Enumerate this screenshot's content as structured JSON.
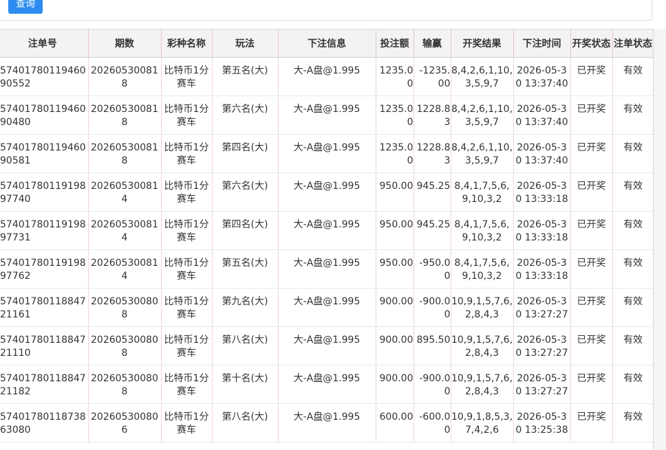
{
  "toolbar": {
    "query_label": "查询"
  },
  "table": {
    "headers": [
      "注单号",
      "期数",
      "彩种名称",
      "玩法",
      "下注信息",
      "投注额",
      "输赢",
      "开奖结果",
      "下注时间",
      "开奖状态",
      "注单状态"
    ],
    "rows": [
      [
        "5740178011946090552",
        "202605300818",
        "比特币1分赛车",
        "第五名(大)",
        "大-A盘@1.995",
        "1235.00",
        "-1235.00",
        "8,4,2,6,1,10,3,5,9,7",
        "2026-05-30 13:37:40",
        "已开奖",
        "有效"
      ],
      [
        "5740178011946090480",
        "202605300818",
        "比特币1分赛车",
        "第六名(大)",
        "大-A盘@1.995",
        "1235.00",
        "1228.83",
        "8,4,2,6,1,10,3,5,9,7",
        "2026-05-30 13:37:40",
        "已开奖",
        "有效"
      ],
      [
        "5740178011946090581",
        "202605300818",
        "比特币1分赛车",
        "第四名(大)",
        "大-A盘@1.995",
        "1235.00",
        "1228.83",
        "8,4,2,6,1,10,3,5,9,7",
        "2026-05-30 13:37:40",
        "已开奖",
        "有效"
      ],
      [
        "5740178011919897740",
        "202605300814",
        "比特币1分赛车",
        "第六名(大)",
        "大-A盘@1.995",
        "950.00",
        "945.25",
        "8,4,1,7,5,6,9,10,3,2",
        "2026-05-30 13:33:18",
        "已开奖",
        "有效"
      ],
      [
        "5740178011919897731",
        "202605300814",
        "比特币1分赛车",
        "第四名(大)",
        "大-A盘@1.995",
        "950.00",
        "945.25",
        "8,4,1,7,5,6,9,10,3,2",
        "2026-05-30 13:33:18",
        "已开奖",
        "有效"
      ],
      [
        "5740178011919897762",
        "202605300814",
        "比特币1分赛车",
        "第五名(大)",
        "大-A盘@1.995",
        "950.00",
        "-950.00",
        "8,4,1,7,5,6,9,10,3,2",
        "2026-05-30 13:33:18",
        "已开奖",
        "有效"
      ],
      [
        "5740178011884721161",
        "202605300808",
        "比特币1分赛车",
        "第九名(大)",
        "大-A盘@1.995",
        "900.00",
        "-900.00",
        "10,9,1,5,7,6,2,8,4,3",
        "2026-05-30 13:27:27",
        "已开奖",
        "有效"
      ],
      [
        "5740178011884721110",
        "202605300808",
        "比特币1分赛车",
        "第八名(大)",
        "大-A盘@1.995",
        "900.00",
        "895.50",
        "10,9,1,5,7,6,2,8,4,3",
        "2026-05-30 13:27:27",
        "已开奖",
        "有效"
      ],
      [
        "5740178011884721182",
        "202605300808",
        "比特币1分赛车",
        "第十名(大)",
        "大-A盘@1.995",
        "900.00",
        "-900.00",
        "10,9,1,5,7,6,2,8,4,3",
        "2026-05-30 13:27:27",
        "已开奖",
        "有效"
      ],
      [
        "5740178011873863080",
        "202605300806",
        "比特币1分赛车",
        "第八名(大)",
        "大-A盘@1.995",
        "600.00",
        "-600.00",
        "10,9,1,8,5,3,7,4,2,6",
        "2026-05-30 13:25:38",
        "已开奖",
        "有效"
      ]
    ]
  }
}
